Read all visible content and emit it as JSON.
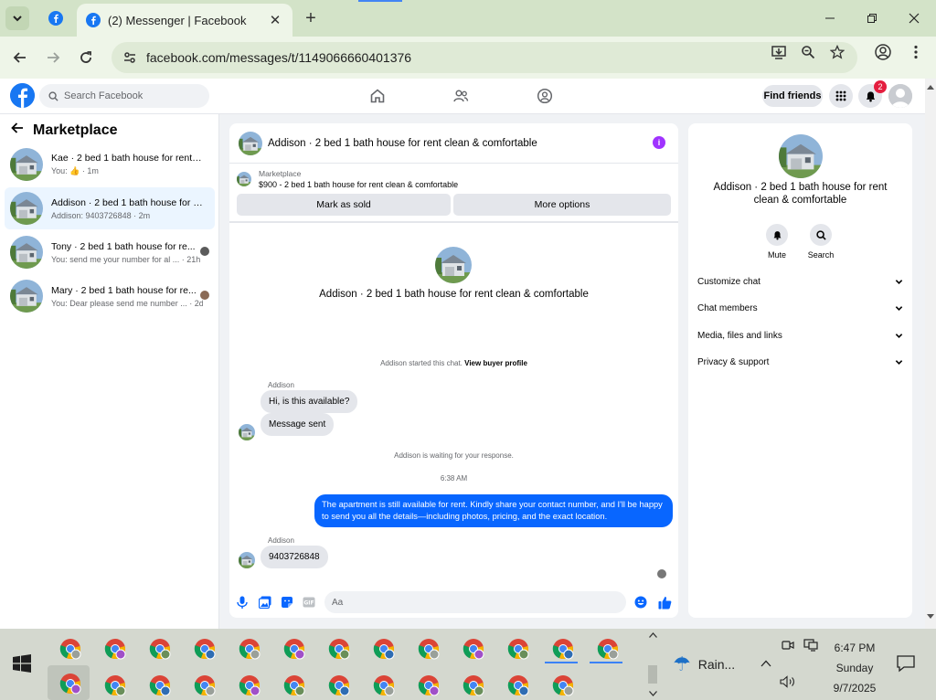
{
  "browser": {
    "tab_title": "(2) Messenger | Facebook",
    "url": "facebook.com/messages/t/1149066660401376",
    "tab_close": "✕",
    "new_tab": "+"
  },
  "fb_header": {
    "search_placeholder": "Search Facebook",
    "find_friends": "Find friends",
    "notification_count": "2"
  },
  "sidebar": {
    "title": "Marketplace",
    "conversations": [
      {
        "name": "Kae · 2 bed 1 bath house for rent c...",
        "preview": "You: 👍 · 1m"
      },
      {
        "name": "Addison · 2 bed 1 bath house for r...",
        "preview": "Addison: 9403726848 · 2m"
      },
      {
        "name": "Tony · 2 bed 1 bath house for re...",
        "preview": "You: send me your number for al ... · 21h"
      },
      {
        "name": "Mary · 2 bed 1 bath house for re...",
        "preview": "You: Dear please send me number ... · 2d"
      }
    ]
  },
  "chat": {
    "header_title": "Addison · 2 bed 1 bath house for rent clean & comfortable",
    "listing_label": "Marketplace",
    "listing_price_title": "$900 - 2 bed 1 bath house for rent clean & comfortable",
    "mark_sold": "Mark as sold",
    "more_options": "More options",
    "hero_title": "Addison · 2 bed 1 bath house for rent clean & comfortable",
    "started_text": "Addison started this chat.",
    "view_profile": "View buyer profile",
    "sender_name_1": "Addison",
    "msg_1": "Hi, is this available?",
    "msg_2": "Message sent",
    "waiting_text": "Addison is waiting for your response.",
    "timestamp": "6:38 AM",
    "outgoing_msg": "The apartment is still available for rent. Kindly share your contact number, and I'll be happy to send you all the details—including photos, pricing, and the exact location.",
    "sender_name_2": "Addison",
    "msg_3": "9403726848",
    "composer_placeholder": "Aa"
  },
  "right_panel": {
    "title": "Addison · 2 bed 1 bath house for rent clean & comfortable",
    "mute": "Mute",
    "search": "Search",
    "sections": [
      "Customize chat",
      "Chat members",
      "Media, files and links",
      "Privacy & support"
    ]
  },
  "taskbar": {
    "weather": "Rain...",
    "time": "6:47 PM",
    "day": "Sunday",
    "date": "9/7/2025"
  },
  "colors": {
    "fb_blue": "#1877f2",
    "messenger_blue": "#0866ff",
    "chrome_frame": "#d3e3c8",
    "info_purple": "#a033ff"
  }
}
